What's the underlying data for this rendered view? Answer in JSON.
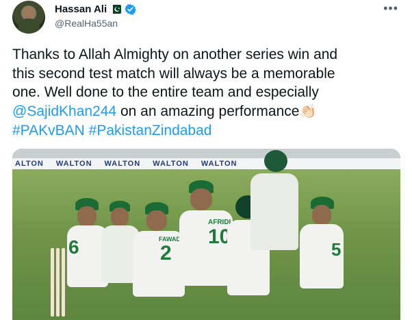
{
  "header": {
    "display_name": "Hassan Ali",
    "handle": "@RealHa55an",
    "more_label": "•••"
  },
  "tweet": {
    "text_line1": "Thanks to Allah Almighty on another series win and",
    "text_line2": "this second test match will always be a memorable",
    "text_line3": "one. Well done to the entire team and especially",
    "mention": "@SajidKhan244",
    "text_line4_rest": " on an amazing performance",
    "clap_emoji": "👏🏻",
    "hashtag1": "#PAKvBAN",
    "hashtag2": "#PakistanZindabad"
  },
  "photo": {
    "hoarding_texts": [
      "ALTON",
      "WALTON",
      "WALTON",
      "WALTON",
      "WALTON"
    ],
    "jersey_numbers": [
      "6",
      "2",
      "10",
      "5"
    ],
    "jersey_names": [
      "FAWAD",
      "AFRIDI"
    ]
  },
  "colors": {
    "link": "#1d9bf0",
    "verified": "#1d9bf0",
    "pakistan_green": "#01411c",
    "text": "#0f1419",
    "muted": "#536471"
  },
  "icons": {
    "flag": "pakistan-flag-icon",
    "verified": "verified-badge-icon",
    "more": "more-options-icon"
  }
}
